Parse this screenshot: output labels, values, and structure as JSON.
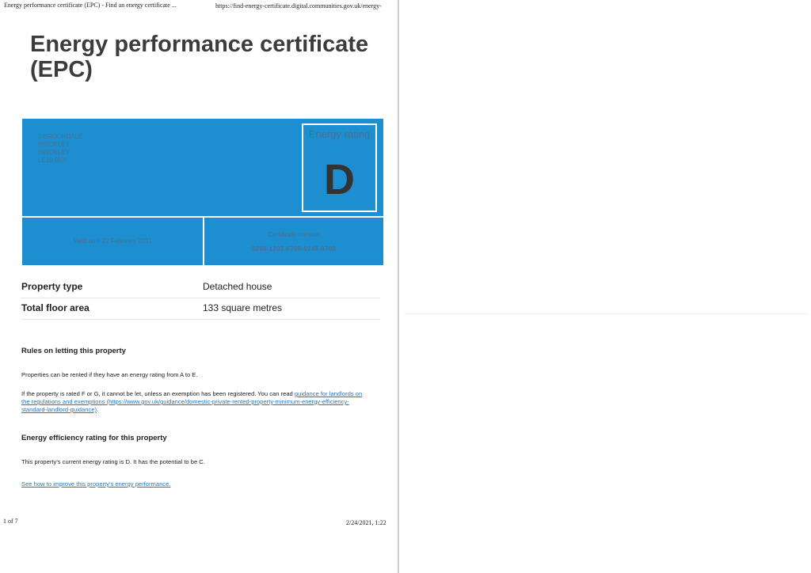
{
  "header": {
    "page_title": "Energy performance certificate (EPC) - Find an energy certificate ...",
    "url": "https://find-energy-certificate.digital.communities.gov.uk/energy-"
  },
  "title": "Energy performance certificate (EPC)",
  "certificate": {
    "address": [
      "2 BROOKDALE",
      "HINCKLEY",
      "HINCKLEY",
      "LE10 0NX"
    ],
    "rating_label": "Energy rating",
    "rating": "D",
    "valid_until": "Valid until 22 February 2031",
    "cert_label": "Certificate number",
    "cert_number": "0290-1203-6709-9248-0700"
  },
  "summary": [
    {
      "label": "Property type",
      "value": "Detached house"
    },
    {
      "label": "Total floor area",
      "value": "133 square metres"
    }
  ],
  "letting": {
    "heading": "Rules on letting this property",
    "p1": "Properties can be rented if they have an energy rating from A to E.",
    "p2_text": "If the property is rated F or G, it cannot be let, unless an exemption has been registered. You can read ",
    "p2_link": "guidance for landlords on the regulations and exemptions (https://www.gov.uk/guidance/domestic-private-rented-property-minimum-energy-efficiency-standard-landlord-guidance)",
    "p2_end": "."
  },
  "efficiency": {
    "heading": "Energy efficiency rating for this property",
    "p1": "This property's current energy rating is D. It has the potential to be C.",
    "link": "See how to improve this property's energy performance."
  },
  "footer": {
    "page": "1 of 7",
    "datetime": "2/24/2021, 1:22"
  },
  "colors": {
    "panel": "#1d8fd0",
    "link": "#2c73b5"
  }
}
